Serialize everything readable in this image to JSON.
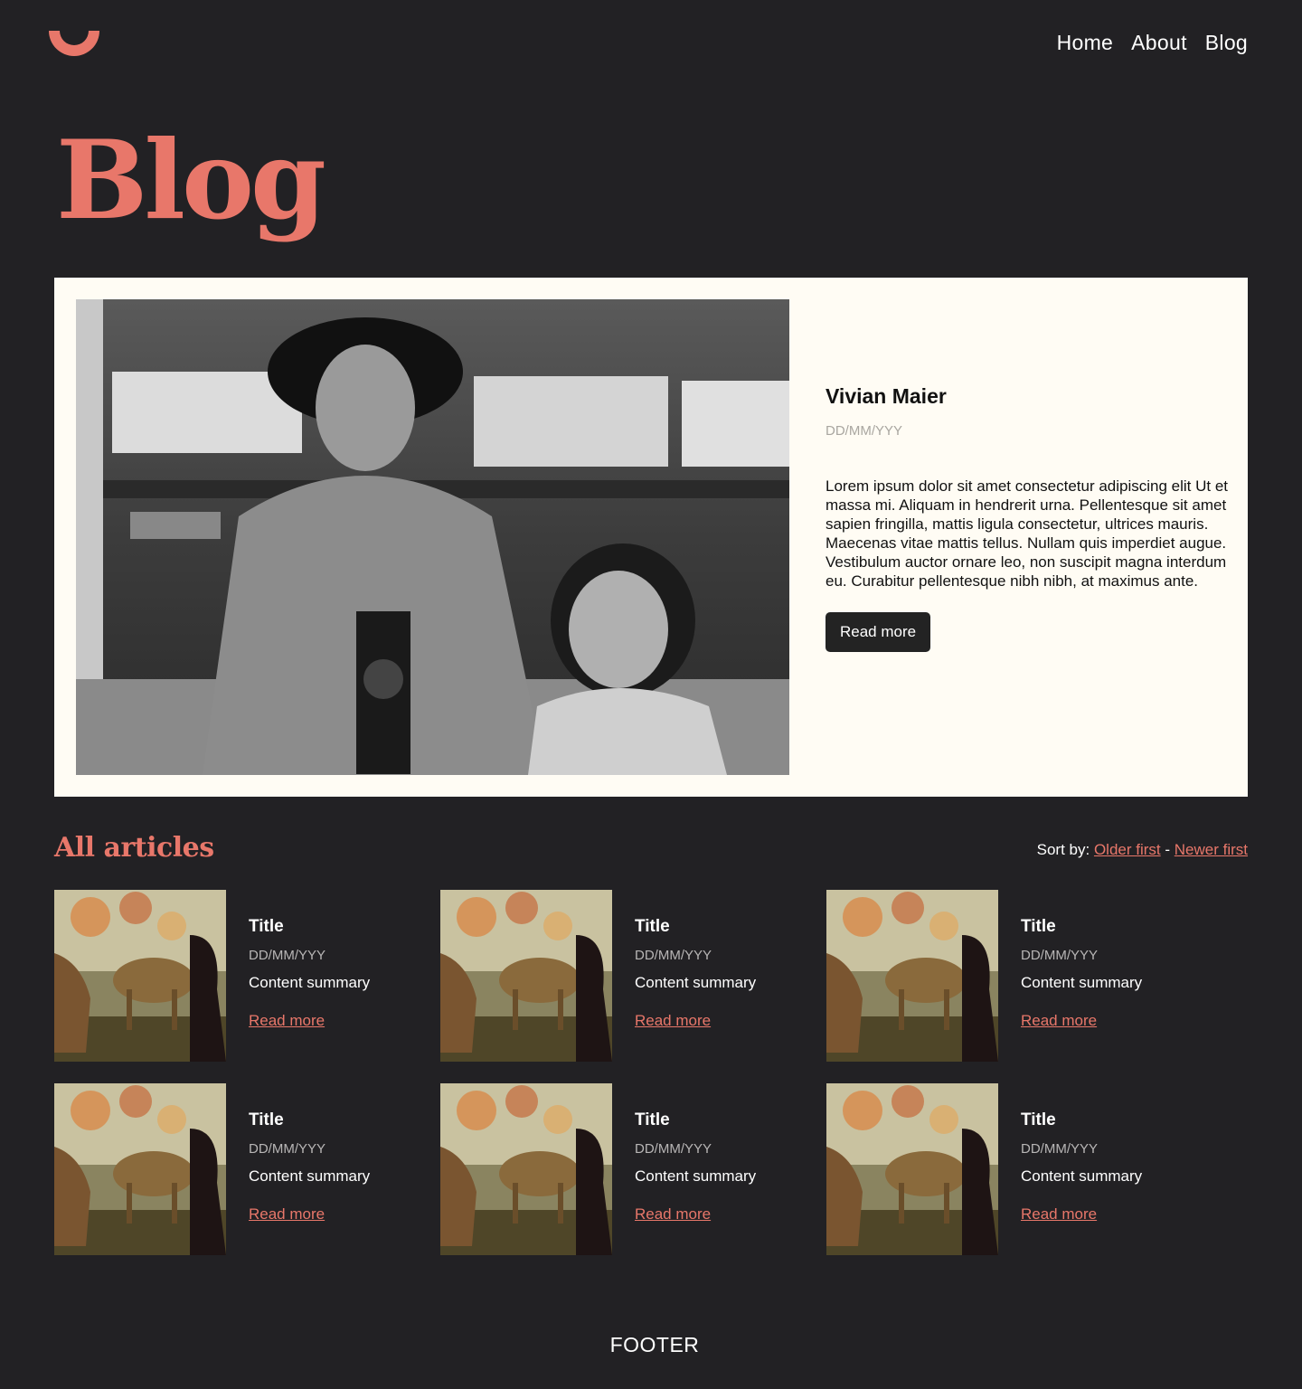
{
  "header": {
    "nav": [
      "Home",
      "About",
      "Blog"
    ]
  },
  "colors": {
    "accent": "#E8776A",
    "background": "#222124",
    "card_bg": "#FFFCF4"
  },
  "page_title": "Blog",
  "featured": {
    "title": "Vivian Maier",
    "date": "DD/MM/YYY",
    "body": "Lorem ipsum dolor sit amet consectetur adipiscing elit Ut et massa mi. Aliquam in hendrerit urna. Pellentesque sit amet sapien fringilla, mattis ligula consectetur, ultrices mauris. Maecenas vitae mattis tellus. Nullam quis imperdiet augue. Vestibulum auctor ornare leo, non suscipit magna interdum eu. Curabitur pellentesque nibh nibh, at maximus ante.",
    "button": "Read more"
  },
  "articles": {
    "heading": "All articles",
    "sort_label": "Sort by:",
    "sort_older": "Older first",
    "sort_sep": "-",
    "sort_newer": "Newer first",
    "items": [
      {
        "title": "Title",
        "date": "DD/MM/YYY",
        "summary": "Content summary",
        "link": "Read more"
      },
      {
        "title": "Title",
        "date": "DD/MM/YYY",
        "summary": "Content summary",
        "link": "Read more"
      },
      {
        "title": "Title",
        "date": "DD/MM/YYY",
        "summary": "Content summary",
        "link": "Read more"
      },
      {
        "title": "Title",
        "date": "DD/MM/YYY",
        "summary": "Content summary",
        "link": "Read more"
      },
      {
        "title": "Title",
        "date": "DD/MM/YYY",
        "summary": "Content summary",
        "link": "Read more"
      },
      {
        "title": "Title",
        "date": "DD/MM/YYY",
        "summary": "Content summary",
        "link": "Read more"
      }
    ]
  },
  "footer": "FOOTER"
}
